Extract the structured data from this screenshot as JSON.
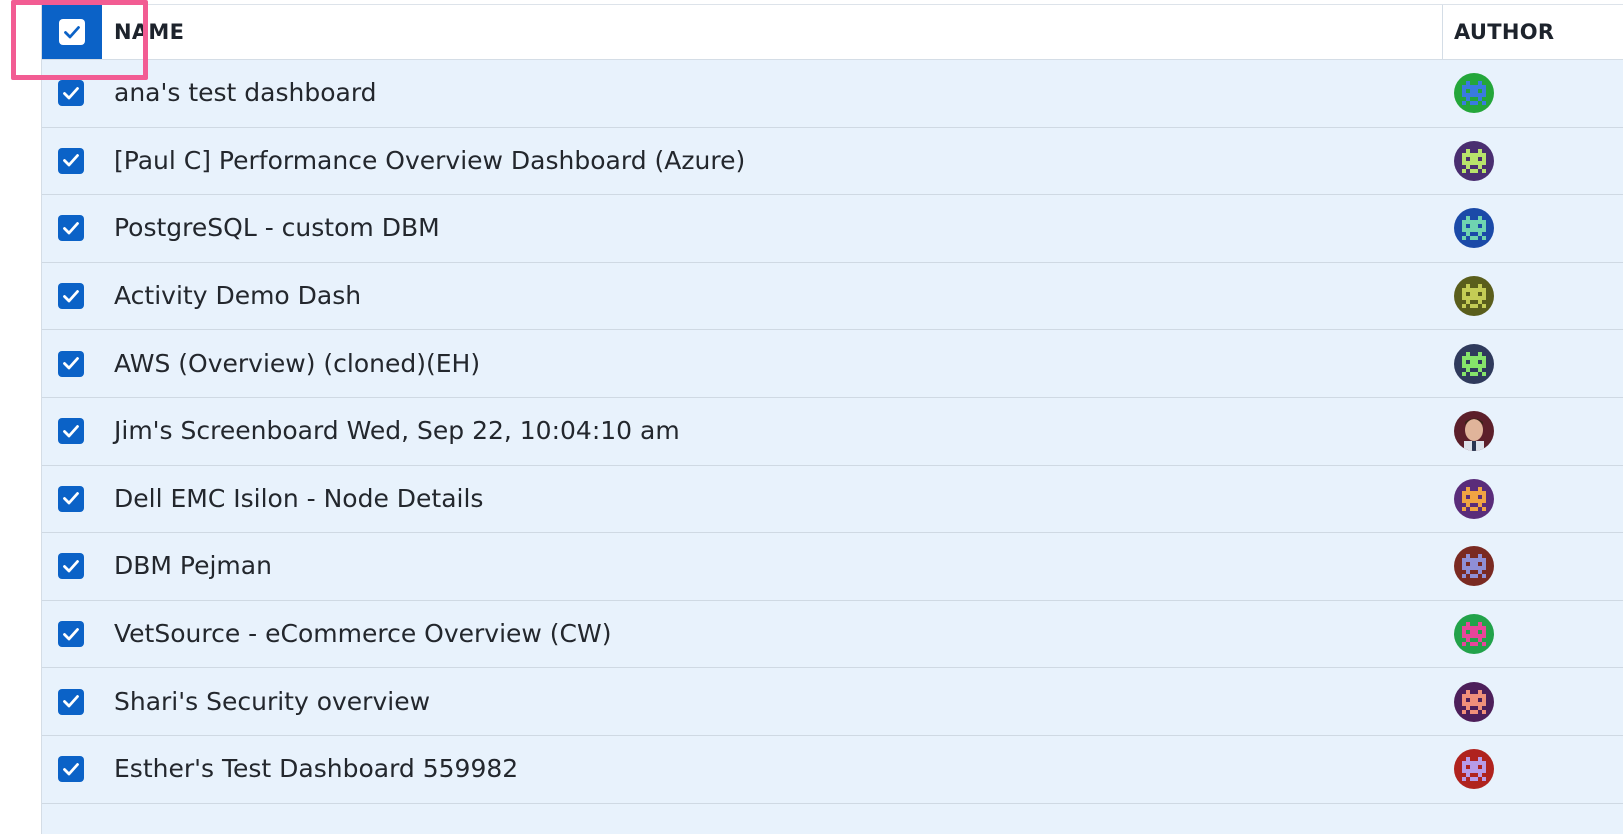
{
  "header": {
    "name_label": "NAME",
    "author_label": "AUTHOR",
    "select_all_checked": true
  },
  "colors": {
    "accent": "#0b62c7",
    "row_background": "#e8f2fc",
    "highlight": "#f25c93"
  },
  "rows": [
    {
      "name": "ana's test dashboard",
      "checked": true,
      "avatar": {
        "bg": "#24a63a",
        "fg": "#3a7ae0"
      }
    },
    {
      "name": "[Paul C] Performance Overview Dashboard (Azure)",
      "checked": true,
      "avatar": {
        "bg": "#4a2e70",
        "fg": "#b8e36b"
      }
    },
    {
      "name": "PostgreSQL - custom DBM",
      "checked": true,
      "avatar": {
        "bg": "#1b4aa8",
        "fg": "#6fd3b0"
      }
    },
    {
      "name": "Activity Demo Dash",
      "checked": true,
      "avatar": {
        "bg": "#5a5e1c",
        "fg": "#c4cc55"
      }
    },
    {
      "name": "AWS (Overview) (cloned)(EH)",
      "checked": true,
      "avatar": {
        "bg": "#2f3a5c",
        "fg": "#86e36a"
      }
    },
    {
      "name": "Jim's Screenboard Wed, Sep 22, 10:04:10 am",
      "checked": true,
      "avatar": {
        "bg": "#5c1f2a",
        "fg": "#e0b49a",
        "photo": true
      }
    },
    {
      "name": "Dell EMC Isilon - Node Details",
      "checked": true,
      "avatar": {
        "bg": "#5a2c7a",
        "fg": "#f0a443"
      }
    },
    {
      "name": "DBM Pejman",
      "checked": true,
      "avatar": {
        "bg": "#7a2a22",
        "fg": "#8f8fd6"
      }
    },
    {
      "name": "VetSource - eCommerce Overview (CW)",
      "checked": true,
      "avatar": {
        "bg": "#22a24a",
        "fg": "#e8469a"
      }
    },
    {
      "name": "Shari's Security overview",
      "checked": true,
      "avatar": {
        "bg": "#4d1f5a",
        "fg": "#f0907a"
      }
    },
    {
      "name": "Esther's Test Dashboard 559982",
      "checked": true,
      "avatar": {
        "bg": "#b0231e",
        "fg": "#b79be8"
      }
    }
  ]
}
